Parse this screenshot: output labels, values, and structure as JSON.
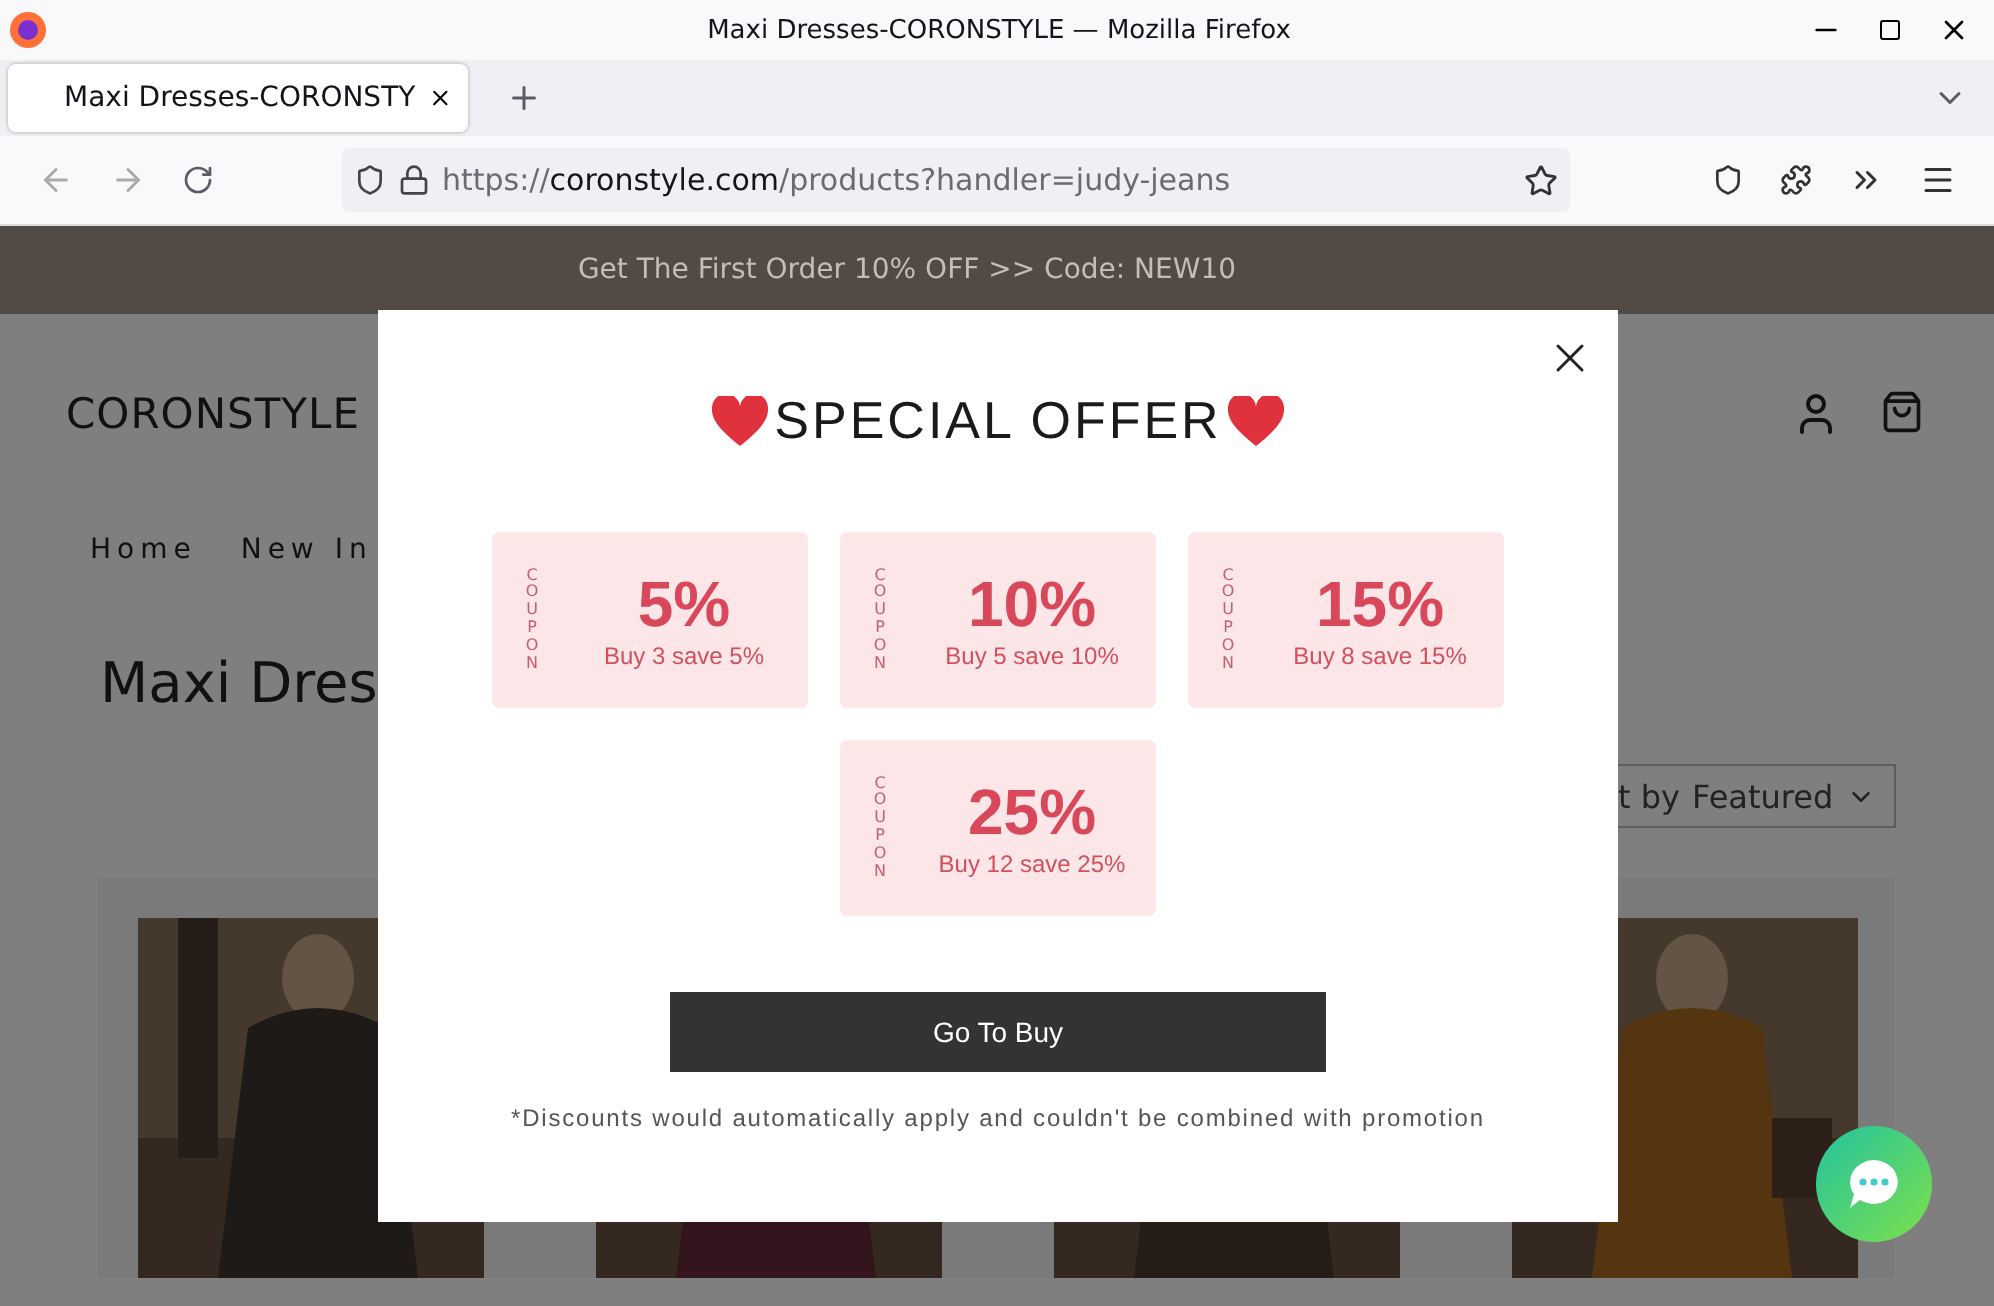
{
  "browser": {
    "window_title": "Maxi Dresses-CORONSTYLE — Mozilla Firefox",
    "tab_title": "Maxi Dresses-CORONSTY",
    "url_scheme": "https://",
    "url_domain": "coronstyle.com",
    "url_path": "/products?handler=judy-jeans"
  },
  "page": {
    "announcement": "Get The First Order 10% OFF >> Code: NEW10",
    "logo": "CORONSTYLE",
    "nav": [
      "Home",
      "New In"
    ],
    "heading": "Maxi Dres",
    "sort": {
      "label": "t by",
      "value": "Featured"
    }
  },
  "modal": {
    "title": "SPECIAL OFFER",
    "coupons": [
      {
        "side": "COUPON",
        "percent": "5%",
        "note": "Buy 3 save 5%"
      },
      {
        "side": "COUPON",
        "percent": "10%",
        "note": "Buy 5 save 10%"
      },
      {
        "side": "COUPON",
        "percent": "15%",
        "note": "Buy 8 save 15%"
      },
      {
        "side": "COUPON",
        "percent": "25%",
        "note": "Buy 12 save 25%"
      }
    ],
    "button": "Go To Buy",
    "disclaimer": "*Discounts would automatically apply and couldn't be combined with promotion"
  }
}
